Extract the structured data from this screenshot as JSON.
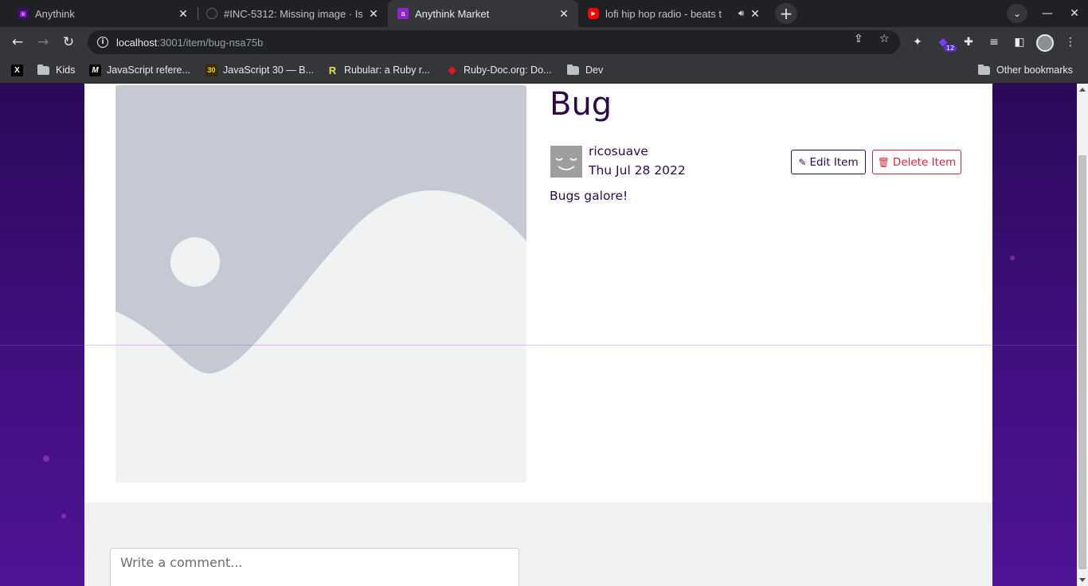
{
  "browser": {
    "tabs": [
      {
        "title": "Anythink",
        "favicon": "anythink-logo-icon",
        "active": false
      },
      {
        "title": "#INC-5312: Missing image · Issu",
        "favicon": "github-icon",
        "active": false
      },
      {
        "title": "Anythink Market",
        "favicon": "anythink-logo-icon",
        "active": true
      },
      {
        "title": "lofi hip hop radio - beats t",
        "favicon": "youtube-icon",
        "active": false,
        "audio": true
      }
    ],
    "url_host": "localhost",
    "url_path": ":3001/item/bug-nsa75b",
    "extension_badge": "12",
    "bookmarks": [
      {
        "label": "",
        "icon": "x-icon"
      },
      {
        "label": "Kids",
        "icon": "folder-icon"
      },
      {
        "label": "JavaScript refere...",
        "icon": "mdn-icon"
      },
      {
        "label": "JavaScript 30 — B...",
        "icon": "js30-icon"
      },
      {
        "label": "Rubular: a Ruby r...",
        "icon": "rubular-icon"
      },
      {
        "label": "Ruby-Doc.org: Do...",
        "icon": "ruby-icon"
      },
      {
        "label": "Dev",
        "icon": "folder-icon"
      }
    ],
    "other_bookmarks": "Other bookmarks"
  },
  "item": {
    "title": "Bug",
    "seller": "ricosuave",
    "date": "Thu Jul 28 2022",
    "description": "Bugs galore!",
    "edit_label": "Edit Item",
    "delete_label": "Delete Item"
  },
  "comments": {
    "placeholder": "Write a comment..."
  },
  "colors": {
    "brand_dark": "#2b0a4a",
    "danger": "#d0263c",
    "background_purple": "#3d0f7a"
  }
}
